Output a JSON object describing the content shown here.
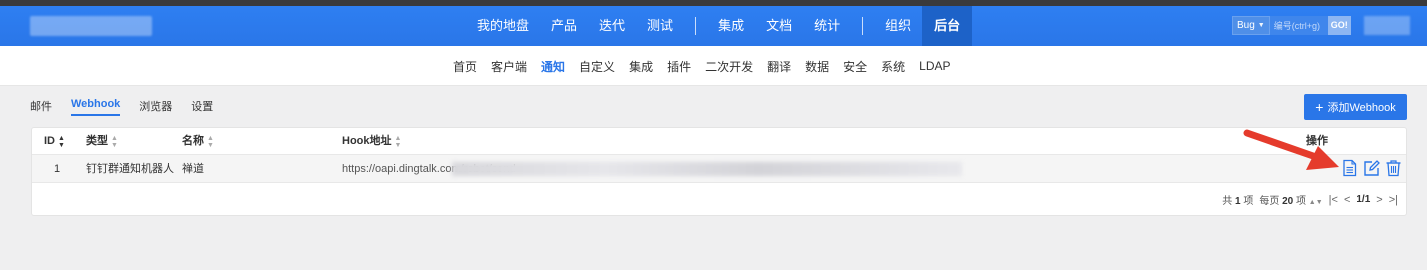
{
  "navbar": {
    "items": [
      "我的地盘",
      "产品",
      "迭代",
      "测试",
      "集成",
      "文档",
      "统计",
      "组织",
      "后台"
    ],
    "active": "后台"
  },
  "search": {
    "type_label": "Bug",
    "placeholder": "编号(ctrl+g)",
    "go_label": "GO!"
  },
  "subnav": {
    "items": [
      "首页",
      "客户端",
      "通知",
      "自定义",
      "集成",
      "插件",
      "二次开发",
      "翻译",
      "数据",
      "安全",
      "系统",
      "LDAP"
    ],
    "active": "通知"
  },
  "tabs": {
    "items": [
      "邮件",
      "Webhook",
      "浏览器",
      "设置"
    ],
    "active": "Webhook"
  },
  "add_button": {
    "label": "添加Webhook"
  },
  "table": {
    "headers": {
      "id": "ID",
      "type": "类型",
      "name": "名称",
      "hook": "Hook地址",
      "actions": "操作"
    },
    "rows": [
      {
        "id": "1",
        "type": "钉钉群通知机器人",
        "name": "禅道",
        "hook": "https://oapi.dingtalk.com/robot/send"
      }
    ]
  },
  "pager": {
    "total_prefix": "共",
    "total": "1",
    "total_suffix": "项",
    "per_page_prefix": "每页",
    "per_page": "20",
    "per_page_suffix": "项",
    "page": "1/1"
  },
  "colors": {
    "brand": "#2a76e8",
    "nav_active": "#1d62c8",
    "annotation_arrow": "#e53b2c"
  },
  "icons": [
    "sort-icon",
    "detail-icon",
    "edit-icon",
    "delete-icon",
    "plus-icon",
    "first-page-icon",
    "prev-page-icon",
    "next-page-icon",
    "last-page-icon",
    "annotation-arrow"
  ]
}
